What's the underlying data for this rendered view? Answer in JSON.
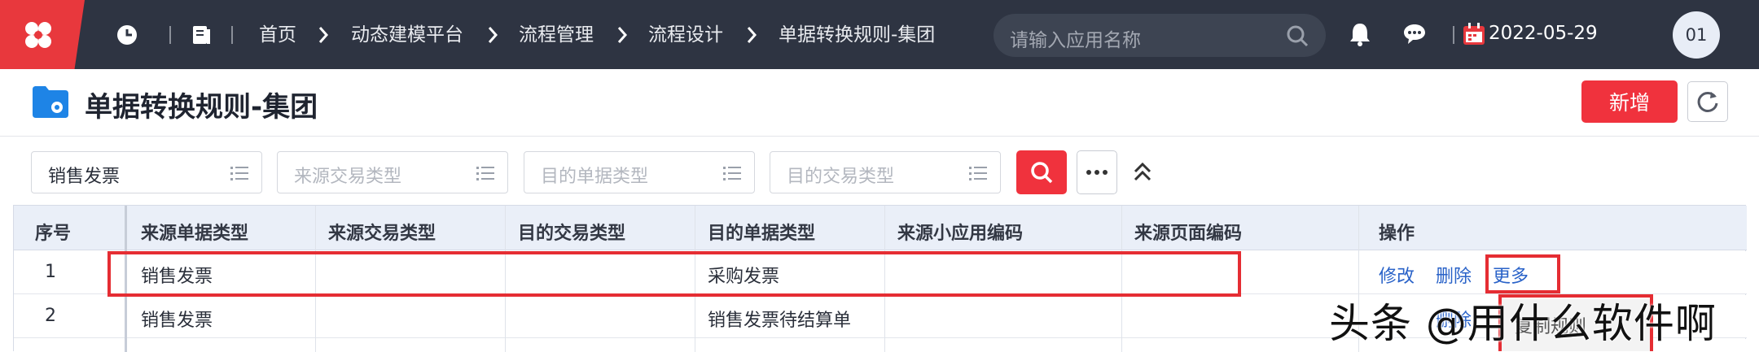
{
  "topbar": {
    "breadcrumbs": [
      "首页",
      "动态建模平台",
      "流程管理",
      "流程设计",
      "单据转换规则-集团"
    ],
    "search_placeholder": "请输入应用名称",
    "date": "2022-05-29",
    "avatar_text": "01",
    "icons": [
      "logo-icon",
      "clock-icon",
      "book-icon",
      "search-icon",
      "bell-icon",
      "chat-icon",
      "calendar-icon"
    ]
  },
  "header": {
    "title": "单据转换规则-集团",
    "add_button": "新增"
  },
  "filters": {
    "source_doc_type_value": "销售发票",
    "source_trans_type_placeholder": "来源交易类型",
    "target_doc_type_placeholder": "目的单据类型",
    "target_trans_type_placeholder": "目的交易类型"
  },
  "table": {
    "columns": [
      "序号",
      "来源单据类型",
      "来源交易类型",
      "目的交易类型",
      "目的单据类型",
      "来源小应用编码",
      "来源页面编码",
      "操作"
    ],
    "rows": [
      {
        "index": "1",
        "source_doc_type": "销售发票",
        "source_trans_type": "",
        "target_trans_type": "",
        "target_doc_type": "采购发票",
        "source_app_code": "",
        "source_page_code": "",
        "actions": [
          "修改",
          "删除",
          "更多"
        ]
      },
      {
        "index": "2",
        "source_doc_type": "销售发票",
        "source_trans_type": "",
        "target_trans_type": "",
        "target_doc_type": "销售发票待结算单",
        "source_app_code": "",
        "source_page_code": "",
        "actions": [
          "删除"
        ]
      }
    ]
  },
  "popup_text": "复制规则",
  "watermark": "头条 @用什么软件啊",
  "colors": {
    "topbar": "#2e3442",
    "accent_red": "#f0323d",
    "link_blue": "#2962c8",
    "table_header": "#eaeff8"
  }
}
